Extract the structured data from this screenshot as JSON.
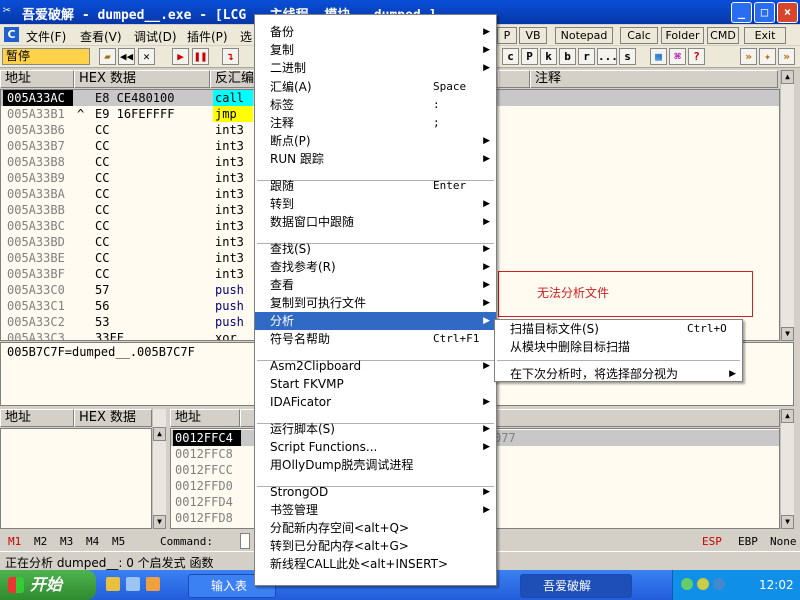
{
  "window": {
    "title": "吾爱破解 - dumped__.exe - [LCG - 主线程, 模块 - dumped_]",
    "buttons": [
      "_",
      "□",
      "×"
    ]
  },
  "menubar": {
    "items": [
      "文件(F)",
      "查看(V)",
      "调试(D)",
      "插件(P)",
      "选"
    ],
    "plugins": [
      "P",
      "VB",
      "Notepad",
      "Calc",
      "Folder",
      "CMD",
      "Exit"
    ]
  },
  "toolbar": {
    "status": "暂停",
    "letters": [
      "c",
      "P",
      "k",
      "b",
      "r",
      "...",
      "s"
    ]
  },
  "cpu": {
    "headers": {
      "address": "地址",
      "hex": "HEX 数据",
      "disasm": "反汇编",
      "comment": "注释"
    },
    "rows": [
      {
        "addr": "005A33AC",
        "mark": "",
        "hex": "E8 CE480100",
        "asm": "call",
        "sel": true
      },
      {
        "addr": "005A33B1",
        "mark": "^",
        "hex": "E9 16FEFFFF",
        "asm": "jmp"
      },
      {
        "addr": "005A33B6",
        "mark": "",
        "hex": "CC",
        "asm": "int3"
      },
      {
        "addr": "005A33B7",
        "mark": "",
        "hex": "CC",
        "asm": "int3"
      },
      {
        "addr": "005A33B8",
        "mark": "",
        "hex": "CC",
        "asm": "int3"
      },
      {
        "addr": "005A33B9",
        "mark": "",
        "hex": "CC",
        "asm": "int3"
      },
      {
        "addr": "005A33BA",
        "mark": "",
        "hex": "CC",
        "asm": "int3"
      },
      {
        "addr": "005A33BB",
        "mark": "",
        "hex": "CC",
        "asm": "int3"
      },
      {
        "addr": "005A33BC",
        "mark": "",
        "hex": "CC",
        "asm": "int3"
      },
      {
        "addr": "005A33BD",
        "mark": "",
        "hex": "CC",
        "asm": "int3"
      },
      {
        "addr": "005A33BE",
        "mark": "",
        "hex": "CC",
        "asm": "int3"
      },
      {
        "addr": "005A33BF",
        "mark": "",
        "hex": "CC",
        "asm": "int3"
      },
      {
        "addr": "005A33C0",
        "mark": "",
        "hex": "57",
        "asm": "push"
      },
      {
        "addr": "005A33C1",
        "mark": "",
        "hex": "56",
        "asm": "push"
      },
      {
        "addr": "005A33C2",
        "mark": "",
        "hex": "53",
        "asm": "push"
      },
      {
        "addr": "005A33C3",
        "mark": "",
        "hex": "33FF",
        "asm": "xor"
      }
    ],
    "info": "005B7C7F=dumped__.005B7C7F"
  },
  "dump": {
    "headers": {
      "address": "地址",
      "hex": "HEX 数据"
    }
  },
  "stack": {
    "header": "地址",
    "rows": [
      {
        "addr": "0012FFC4",
        "sel": true
      },
      {
        "addr": "0012FFC8"
      },
      {
        "addr": "0012FFCC"
      },
      {
        "addr": "0012FFD0"
      },
      {
        "addr": "0012FFD4"
      },
      {
        "addr": "0012FFD8"
      }
    ],
    "partial": "077"
  },
  "annotation": {
    "text": "无法分析文件",
    "border_color": "#cc2222"
  },
  "context_menu": [
    {
      "label": "备份",
      "shortcut": "",
      "arrow": true
    },
    {
      "label": "复制",
      "shortcut": "",
      "arrow": true
    },
    {
      "label": "二进制",
      "shortcut": "",
      "arrow": true
    },
    {
      "label": "汇编(A)",
      "shortcut": "Space",
      "arrow": false
    },
    {
      "label": "标签",
      "shortcut": ":",
      "arrow": false
    },
    {
      "label": "注释",
      "shortcut": ";",
      "arrow": false
    },
    {
      "label": "断点(P)",
      "shortcut": "",
      "arrow": true
    },
    {
      "label": "RUN 跟踪",
      "shortcut": "",
      "arrow": true
    },
    {
      "label": "跟随",
      "shortcut": "Enter",
      "arrow": false
    },
    {
      "label": "转到",
      "shortcut": "",
      "arrow": true
    },
    {
      "label": "数据窗口中跟随",
      "shortcut": "",
      "arrow": true
    },
    {
      "label": "查找(S)",
      "shortcut": "",
      "arrow": true
    },
    {
      "label": "查找参考(R)",
      "shortcut": "",
      "arrow": true
    },
    {
      "label": "查看",
      "shortcut": "",
      "arrow": true
    },
    {
      "label": "复制到可执行文件",
      "shortcut": "",
      "arrow": true
    },
    {
      "label": "分析",
      "shortcut": "",
      "arrow": true,
      "highlighted": true
    },
    {
      "label": "符号名帮助",
      "shortcut": "Ctrl+F1",
      "arrow": false
    },
    {
      "label": "Asm2Clipboard",
      "shortcut": "",
      "arrow": true
    },
    {
      "label": "Start FKVMP",
      "shortcut": "",
      "arrow": false
    },
    {
      "label": "IDAFicator",
      "shortcut": "",
      "arrow": true
    },
    {
      "label": "运行脚本(S)",
      "shortcut": "",
      "arrow": true
    },
    {
      "label": "Script Functions...",
      "shortcut": "",
      "arrow": true
    },
    {
      "label": "用OllyDump脱壳调试进程",
      "shortcut": "",
      "arrow": false
    },
    {
      "label": "StrongOD",
      "shortcut": "",
      "arrow": true
    },
    {
      "label": "书签管理",
      "shortcut": "",
      "arrow": true
    },
    {
      "label": "分配新内存空间<alt+Q>",
      "shortcut": "",
      "arrow": false
    },
    {
      "label": "转到已分配内存<alt+G>",
      "shortcut": "",
      "arrow": false
    },
    {
      "label": "新线程CALL此处<alt+INSERT>",
      "shortcut": "",
      "arrow": false
    }
  ],
  "submenu": [
    {
      "label": "扫描目标文件(S)",
      "shortcut": "Ctrl+O",
      "arrow": false
    },
    {
      "label": "从模块中删除目标扫描",
      "shortcut": "",
      "arrow": false
    },
    {
      "label": "在下次分析时，将选择部分视为",
      "shortcut": "",
      "arrow": true
    }
  ],
  "mbar": {
    "items": [
      "M1",
      "M2",
      "M3",
      "M4",
      "M5"
    ],
    "command_label": "Command:",
    "regs": [
      "ESP",
      "EBP",
      "None"
    ]
  },
  "statusbar": {
    "text": "正在分析 dumped__: 0 个启发式 函数"
  },
  "taskbar": {
    "start": "开始",
    "tasks": [
      "输入表",
      "吾爱破解"
    ],
    "clock": "12:02"
  }
}
